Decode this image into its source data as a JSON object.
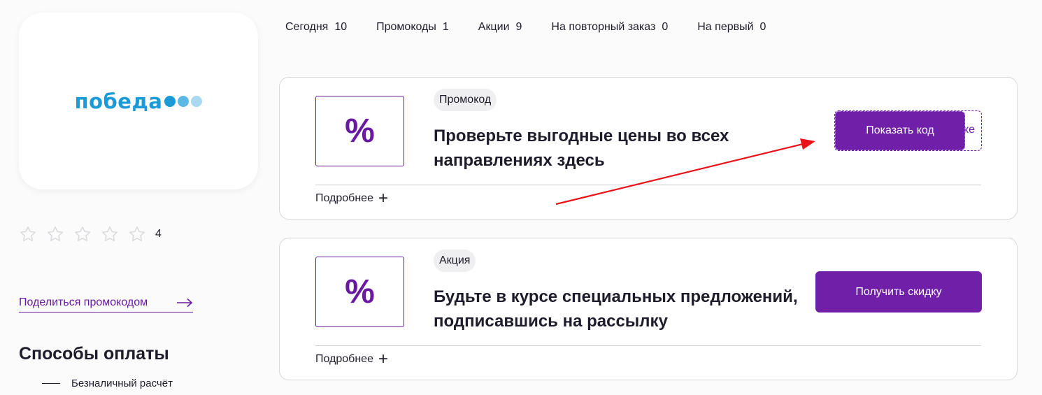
{
  "brand": {
    "logo_text": "победа",
    "dot_colors": [
      "#1a9bd7",
      "#5cb9e6",
      "#a8d8f2"
    ]
  },
  "rating": {
    "stars_total": 5,
    "stars_filled": 0,
    "count": "4"
  },
  "share": {
    "label": "Поделиться промокодом"
  },
  "payment": {
    "title": "Способы оплаты",
    "items": [
      "Безналичный расчёт"
    ]
  },
  "tabs": [
    {
      "label": "Сегодня",
      "count": "10"
    },
    {
      "label": "Промокоды",
      "count": "1"
    },
    {
      "label": "Акции",
      "count": "9"
    },
    {
      "label": "На повторный заказ",
      "count": "0"
    },
    {
      "label": "На первый",
      "count": "0"
    }
  ],
  "offers": [
    {
      "icon_glyph": "%",
      "badge": "Промокод",
      "title": "Проверьте выгодные цены во всех направлениях здесь",
      "more_label": "Подробнее",
      "button_label": "Показать код",
      "code_tail": "ке"
    },
    {
      "icon_glyph": "%",
      "badge": "Акция",
      "title": "Будьте в курсе специальных предложений, подписавшись на рассылку",
      "more_label": "Подробнее",
      "button_label": "Получить скидку"
    }
  ],
  "colors": {
    "accent": "#7020a8",
    "annotation_arrow": "#e8141a",
    "logo_blue": "#1a9bd7"
  }
}
